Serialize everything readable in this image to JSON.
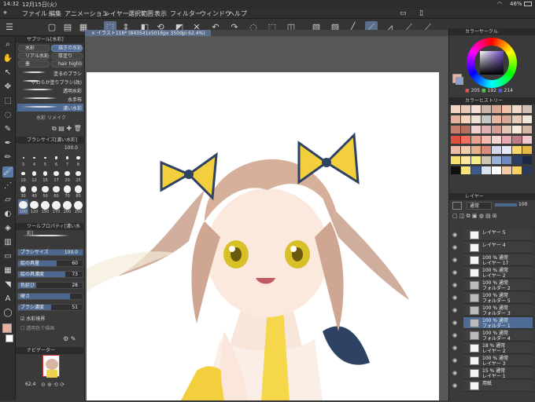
{
  "status": {
    "time": "14:32",
    "date": "12月15日(火)",
    "battery": "46%"
  },
  "menu": [
    "ファイル",
    "編集",
    "アニメーション",
    "レイヤー",
    "選択範囲",
    "表示",
    "フィルター",
    "ウィンドウ",
    "ヘルプ"
  ],
  "tab": {
    "title": "イラスト116* (843541x5016px 350dpi 62.4%)"
  },
  "subtool": {
    "header": "サブツール[水彩]",
    "groups": [
      {
        "label": "水彩",
        "selected": false
      },
      {
        "label": "描きの水彩",
        "selected": true
      },
      {
        "label": "リアル水彩",
        "selected": false
      },
      {
        "label": "厚塗り",
        "selected": false
      },
      {
        "label": "墨",
        "selected": false
      },
      {
        "label": "hair highlig",
        "selected": false
      }
    ],
    "brushes": [
      "塗るのブラシ",
      "やわらか塗りブラシ(改)",
      "透明水彩",
      "水手布",
      "濃い水彩"
    ],
    "selected_index": 4,
    "footer": "水彩",
    "footer2": "リメイク"
  },
  "brushsize": {
    "header": "ブラシサイズ[濃い水彩]",
    "value": "100.0",
    "sizes": [
      "3",
      "4",
      "5",
      "6",
      "7",
      "8",
      "10",
      "12",
      "15",
      "17",
      "20",
      "25",
      "30",
      "40",
      "50",
      "60",
      "70",
      "80",
      "100",
      "120",
      "150",
      "170",
      "200",
      "250"
    ]
  },
  "toolprop": {
    "header": "ツールプロパティ[濃い水彩]",
    "name": "濃い水彩",
    "sliders": [
      {
        "label": "ブラシサイズ",
        "value": "100.0",
        "pct": 1.0
      },
      {
        "label": "絵の具量",
        "value": "60",
        "pct": 0.6
      },
      {
        "label": "絵の具濃度",
        "value": "73",
        "pct": 0.73
      },
      {
        "label": "色延び",
        "value": "28",
        "pct": 0.28
      },
      {
        "label": "硬さ",
        "value": "",
        "pct": 0.8
      },
      {
        "label": "ブラシ濃度",
        "value": "51",
        "pct": 0.51
      }
    ],
    "checks": [
      "水彩境界",
      "透明色で描画"
    ]
  },
  "navigator": {
    "header": "ナビゲーター",
    "zoom": "62.4"
  },
  "colorcircle": {
    "header": "カラーサークル",
    "h": "205",
    "s": "192",
    "v": "214"
  },
  "history": {
    "header": "カラーヒストリー",
    "colors": [
      "#f3d3c3",
      "#e9c8b5",
      "#f5e2d4",
      "#c9b6a8",
      "#d7a88f",
      "#efc1a8",
      "#f1d9c9",
      "#d2c0b5",
      "#e6b29c",
      "#f6d4c0",
      "#efe2d7",
      "#c7c7c7",
      "#e7b89f",
      "#d8a696",
      "#e6cbb8",
      "#f2e5da",
      "#c57d69",
      "#b56f5e",
      "#f0cfcf",
      "#e0b1b0",
      "#d99d98",
      "#e3c6b4",
      "#f8e9dc",
      "#d6b8a6",
      "#e24f3d",
      "#f06e5e",
      "#e9a28f",
      "#f5b8b0",
      "#f6d5d0",
      "#e6aab0",
      "#c07c86",
      "#f3c5cc",
      "#f0b9a5",
      "#f1cdb0",
      "#e6b28e",
      "#d98b7c",
      "#d4d8ee",
      "#e8ebf7",
      "#f6d96a",
      "#e4b944",
      "#f7df70",
      "#fae7a0",
      "#f5ef8e",
      "#d0c6b0",
      "#9bb2d8",
      "#6d89c1",
      "#2b3e64",
      "#1e2a45",
      "#111111",
      "#f7e27b",
      "#3b5b8b",
      "#d9e3f0",
      "#ffffff",
      "#f3c9a8",
      "#f7d060",
      "#2a3a5e"
    ]
  },
  "layers": {
    "header": "レイヤー",
    "blend": "通常",
    "opacity": "100",
    "items": [
      {
        "name": "レイヤー 5",
        "sub": "",
        "sel": false
      },
      {
        "name": "レイヤー 4",
        "sub": "",
        "sel": false
      },
      {
        "name": "レイヤー 17",
        "sub": "100 % 通常",
        "sel": false
      },
      {
        "name": "レイヤー 2",
        "sub": "100 % 通常",
        "sel": false
      },
      {
        "name": "フォルダー 2",
        "sub": "100 % 通常",
        "sel": false
      },
      {
        "name": "フォルダー 5",
        "sub": "100 % 通常",
        "sel": false
      },
      {
        "name": "フォルダー 3",
        "sub": "100 % 通常",
        "sel": false
      },
      {
        "name": "フォルダー 1",
        "sub": "100 % 通常",
        "sel": true
      },
      {
        "name": "フォルダー 4",
        "sub": "100 % 通常",
        "sel": false
      },
      {
        "name": "レイヤー 2",
        "sub": "18 % 通常",
        "sel": false
      },
      {
        "name": "レイヤー 3",
        "sub": "100 % 通常",
        "sel": false
      },
      {
        "name": "レイヤー 1",
        "sub": "15 % 通常",
        "sel": false
      },
      {
        "name": "用紙",
        "sub": "",
        "sel": false
      }
    ]
  },
  "accent": "#5b6f8d"
}
